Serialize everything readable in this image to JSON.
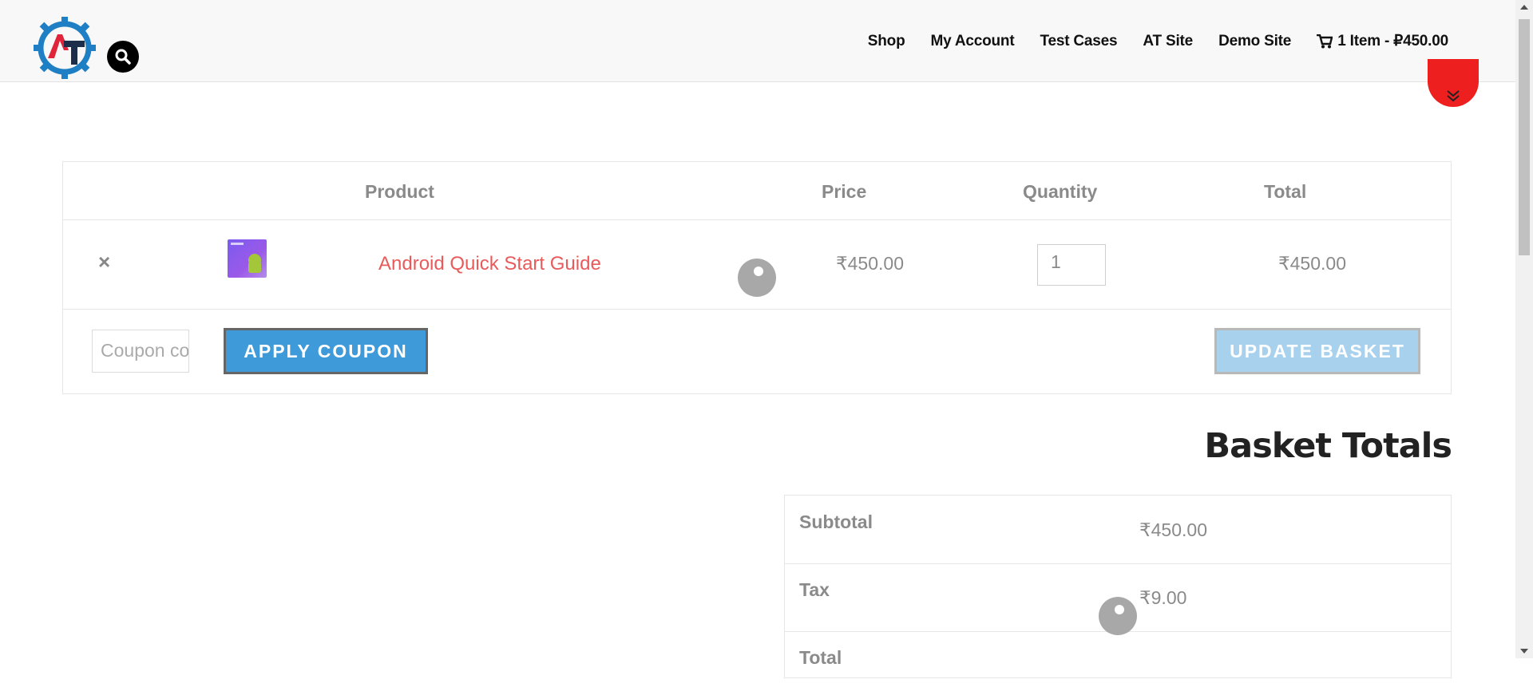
{
  "header": {
    "nav": [
      {
        "label": "Shop"
      },
      {
        "label": "My Account"
      },
      {
        "label": "Test Cases"
      },
      {
        "label": "AT Site"
      },
      {
        "label": "Demo Site"
      }
    ],
    "cart_label": "1 Item - ₽450.00"
  },
  "cart": {
    "headers": {
      "product": "Product",
      "price": "Price",
      "quantity": "Quantity",
      "total": "Total"
    },
    "item": {
      "remove": "×",
      "name": "Android Quick Start Guide",
      "price": "₹450.00",
      "quantity": "1",
      "total": "₹450.00"
    },
    "coupon_placeholder": "Coupon code",
    "apply_label": "APPLY COUPON",
    "update_label": "UPDATE BASKET"
  },
  "totals": {
    "title": "Basket Totals",
    "subtotal_label": "Subtotal",
    "subtotal_value": "₹450.00",
    "tax_label": "Tax",
    "tax_value": "₹9.00",
    "total_label": "Total"
  },
  "colors": {
    "brand_blue": "#3f9ad9",
    "link_red": "#e95b5b",
    "badge_red": "#ee1f1f"
  }
}
